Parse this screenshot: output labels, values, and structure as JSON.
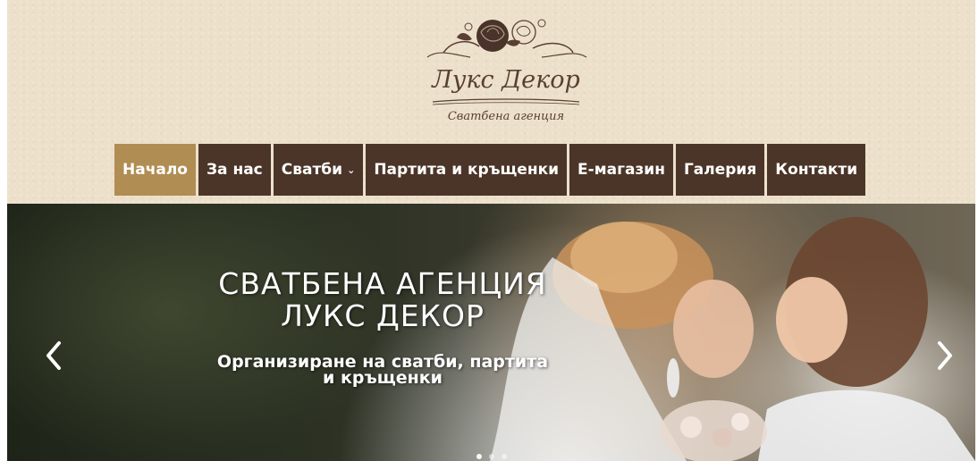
{
  "logo": {
    "brand": "Лукс Декор",
    "tagline": "Сватбена агенция"
  },
  "nav": {
    "items": [
      {
        "label": "Начало",
        "active": true
      },
      {
        "label": "За нас"
      },
      {
        "label": "Сватби",
        "caret": "⌄"
      },
      {
        "label": "Партита и кръщенки"
      },
      {
        "label": "Е-магазин"
      },
      {
        "label": "Галерия"
      },
      {
        "label": "Контакти"
      }
    ]
  },
  "hero": {
    "title_line1": "СВАТБЕНА АГЕНЦИЯ",
    "title_line2": "ЛУКС ДЕКОР",
    "subtitle_line1": "Организиране на сватби, партита",
    "subtitle_line2": "и кръщенки",
    "prev_icon": "chevron-left-icon",
    "next_icon": "chevron-right-icon",
    "slide_count": 3,
    "active_slide": 1
  },
  "colors": {
    "header_bg": "#ece0cb",
    "nav_bg": "#4b3528",
    "nav_active_bg": "#b08d52",
    "logo_brown": "#5a3e33"
  }
}
